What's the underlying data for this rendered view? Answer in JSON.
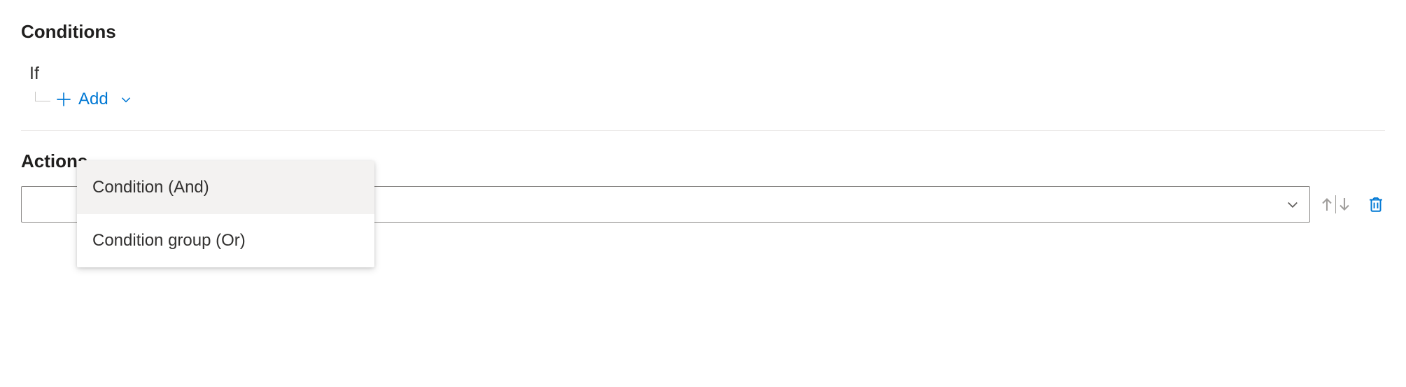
{
  "conditions": {
    "heading": "Conditions",
    "if_label": "If",
    "add_label": "Add",
    "menu": {
      "option_and": "Condition (And)",
      "option_or": "Condition group (Or)"
    }
  },
  "actions": {
    "heading": "Actions",
    "select_value": ""
  }
}
